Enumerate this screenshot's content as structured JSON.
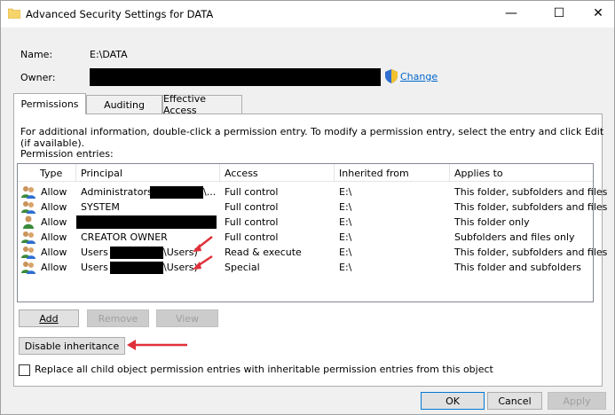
{
  "window": {
    "title": "Advanced Security Settings for DATA",
    "minimize": "—",
    "maximize": "☐",
    "close": "✕"
  },
  "fields": {
    "name_label": "Name:",
    "name_value": "E:\\DATA",
    "owner_label": "Owner:",
    "change_link": "Change"
  },
  "tabs": [
    {
      "label": "Permissions",
      "active": true
    },
    {
      "label": "Auditing",
      "active": false
    },
    {
      "label": "Effective Access",
      "active": false
    }
  ],
  "permissions": {
    "info_text": "For additional information, double-click a permission entry. To modify a permission entry, select the entry and click Edit (if available).",
    "entries_label": "Permission entries:",
    "columns": [
      "Type",
      "Principal",
      "Access",
      "Inherited from",
      "Applies to"
    ],
    "rows": [
      {
        "type": "Allow",
        "principal_prefix": "Administrators (",
        "principal_suffix": "\\...",
        "access": "Full control",
        "inherited": "E:\\",
        "applies": "This folder, subfolders and files",
        "icon": "group"
      },
      {
        "type": "Allow",
        "principal_prefix": "SYSTEM",
        "principal_suffix": "",
        "access": "Full control",
        "inherited": "E:\\",
        "applies": "This folder, subfolders and files",
        "icon": "group"
      },
      {
        "type": "Allow",
        "principal_prefix": "",
        "principal_suffix": "",
        "access": "Full control",
        "inherited": "E:\\",
        "applies": "This folder only",
        "icon": "user"
      },
      {
        "type": "Allow",
        "principal_prefix": "CREATOR OWNER",
        "principal_suffix": "",
        "access": "Full control",
        "inherited": "E:\\",
        "applies": "Subfolders and files only",
        "icon": "group"
      },
      {
        "type": "Allow",
        "principal_prefix": "Users (",
        "principal_suffix": "\\Users)",
        "access": "Read & execute",
        "inherited": "E:\\",
        "applies": "This folder, subfolders and files",
        "icon": "group"
      },
      {
        "type": "Allow",
        "principal_prefix": "Users (",
        "principal_suffix": "\\Users)",
        "access": "Special",
        "inherited": "E:\\",
        "applies": "This folder and subfolders",
        "icon": "group"
      }
    ]
  },
  "buttons": {
    "add": "Add",
    "remove": "Remove",
    "view": "View",
    "disable_inheritance": "Disable inheritance",
    "ok": "OK",
    "cancel": "Cancel",
    "apply": "Apply"
  },
  "checkbox": {
    "label": "Replace all child object permission entries with inheritable permission entries from this object",
    "checked": false
  },
  "colors": {
    "accent": "#0078d7",
    "link": "#0066cc",
    "annotation_arrow": "#e0303a"
  }
}
